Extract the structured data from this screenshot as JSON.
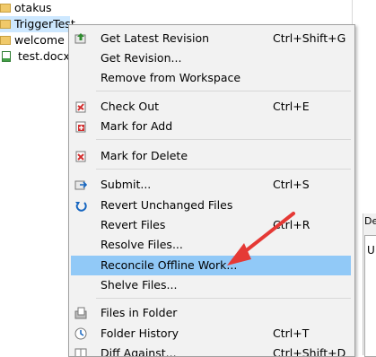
{
  "tree": {
    "items": [
      {
        "label": "otakus",
        "icon": "folder-icon"
      },
      {
        "label": "TriggerTest",
        "icon": "folder-icon"
      },
      {
        "label": "welcome",
        "icon": "folder-icon"
      },
      {
        "label": "test.docx",
        "icon": "document-icon"
      }
    ]
  },
  "side_panel": {
    "tab_label": "De",
    "field_text": "U"
  },
  "context_menu": {
    "items": [
      {
        "label": "Get Latest Revision",
        "shortcut": "Ctrl+Shift+G",
        "icon": "get-latest-icon"
      },
      {
        "label": "Get Revision...",
        "shortcut": "",
        "icon": ""
      },
      {
        "label": "Remove from Workspace",
        "shortcut": "",
        "icon": ""
      },
      {
        "label": "Check Out",
        "shortcut": "Ctrl+E",
        "icon": "check-out-icon"
      },
      {
        "label": "Mark for Add",
        "shortcut": "",
        "icon": "mark-add-icon"
      },
      {
        "label": "Mark for Delete",
        "shortcut": "",
        "icon": "mark-delete-icon"
      },
      {
        "label": "Submit...",
        "shortcut": "Ctrl+S",
        "icon": "submit-icon"
      },
      {
        "label": "Revert Unchanged Files",
        "shortcut": "",
        "icon": "revert-unchanged-icon"
      },
      {
        "label": "Revert Files",
        "shortcut": "Ctrl+R",
        "icon": ""
      },
      {
        "label": "Resolve Files...",
        "shortcut": "",
        "icon": ""
      },
      {
        "label": "Reconcile Offline Work...",
        "shortcut": "",
        "icon": ""
      },
      {
        "label": "Shelve Files...",
        "shortcut": "",
        "icon": ""
      },
      {
        "label": "Files in Folder",
        "shortcut": "",
        "icon": "files-in-folder-icon"
      },
      {
        "label": "Folder History",
        "shortcut": "Ctrl+T",
        "icon": "folder-history-icon"
      },
      {
        "label": "Diff Against...",
        "shortcut": "Ctrl+Shift+D",
        "icon": "diff-icon"
      }
    ],
    "highlighted": "Reconcile Offline Work...",
    "highlight_color": "#91c9f7"
  },
  "annotation": {
    "arrow_color": "#e53935"
  }
}
